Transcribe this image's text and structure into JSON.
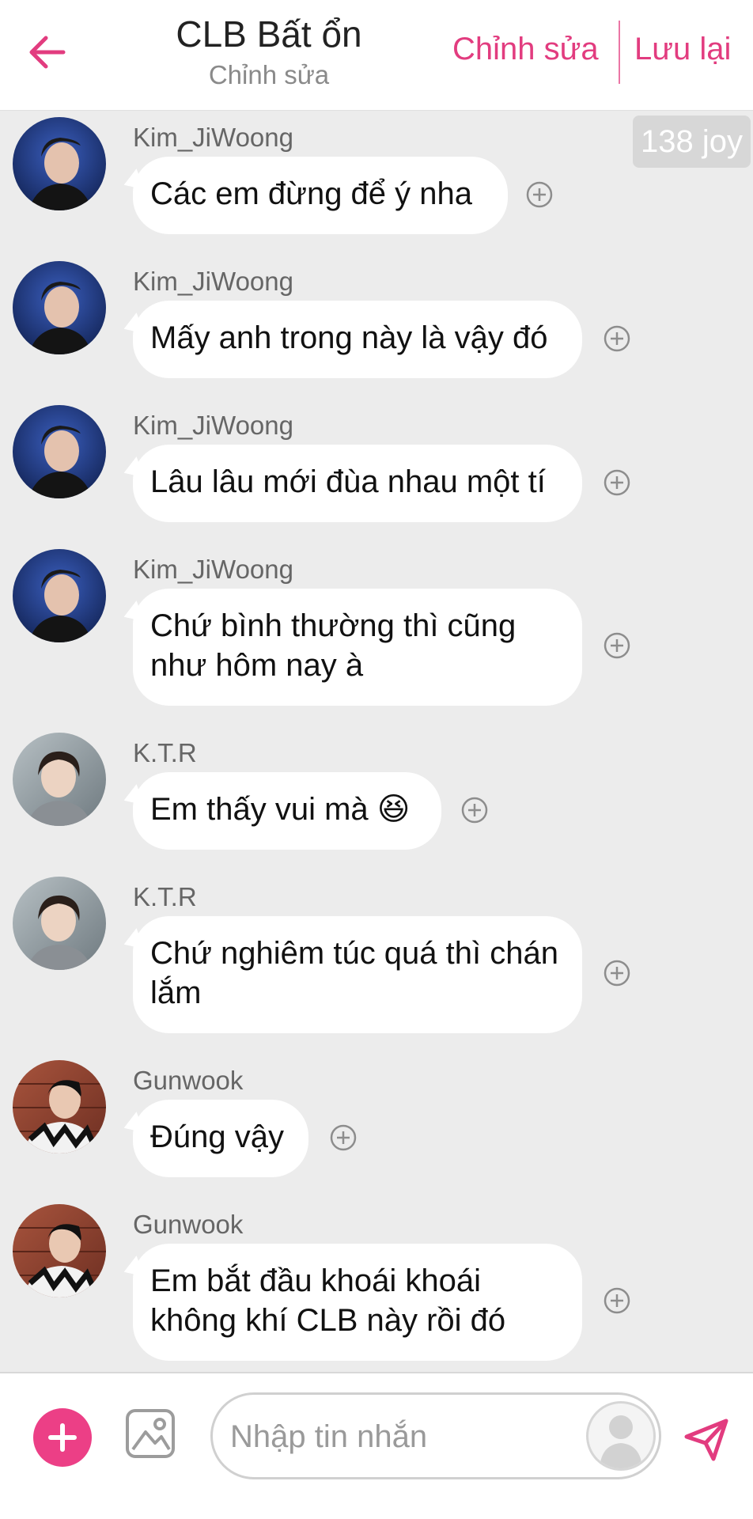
{
  "header": {
    "title": "CLB Bất ổn",
    "subtitle": "Chỉnh sửa",
    "edit_label": "Chỉnh sửa",
    "save_label": "Lưu lại"
  },
  "joy_badge": "138 joy",
  "messages": [
    {
      "sender": "Kim_JiWoong",
      "text": "Các em đừng để ý nha"
    },
    {
      "sender": "Kim_JiWoong",
      "text": "Mấy anh trong này là vậy đó"
    },
    {
      "sender": "Kim_JiWoong",
      "text": "Lâu lâu mới đùa nhau một tí"
    },
    {
      "sender": "Kim_JiWoong",
      "text": "Chứ bình thường thì cũng như hôm nay à"
    },
    {
      "sender": "K.T.R",
      "text": "Em thấy vui mà 😆"
    },
    {
      "sender": "K.T.R",
      "text": "Chứ nghiêm túc quá thì chán lắm"
    },
    {
      "sender": "Gunwook",
      "text": "Đúng vậy"
    },
    {
      "sender": "Gunwook",
      "text": "Em bắt đầu khoái khoái không khí CLB này rồi đó"
    }
  ],
  "composer": {
    "placeholder": "Nhập tin nhắn"
  },
  "colors": {
    "accent": "#e23c7f",
    "plus_button": "#ec3f86",
    "background": "#ececec"
  },
  "icons": [
    "back-arrow-icon",
    "add-reaction-icon",
    "plus-icon",
    "image-icon",
    "user-avatar-icon",
    "send-icon"
  ]
}
